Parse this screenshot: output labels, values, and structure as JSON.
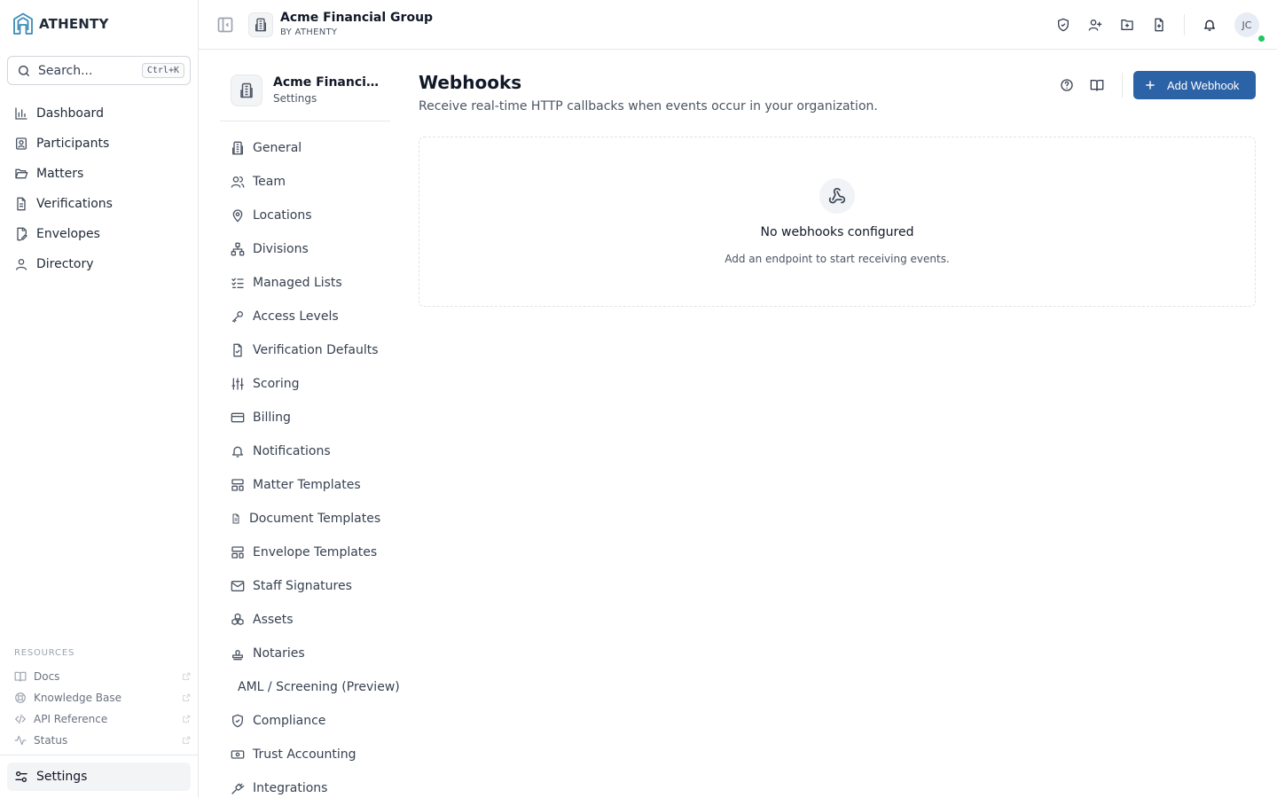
{
  "brand": {
    "name": "ATHENTY",
    "icon": "athenty-logo-icon"
  },
  "search": {
    "placeholder": "Search...",
    "shortcut": "Ctrl+K"
  },
  "nav": [
    {
      "label": "Dashboard",
      "icon": "bar-chart-icon"
    },
    {
      "label": "Participants",
      "icon": "contact-card-icon"
    },
    {
      "label": "Matters",
      "icon": "folder-open-icon"
    },
    {
      "label": "Verifications",
      "icon": "file-text-icon"
    },
    {
      "label": "Envelopes",
      "icon": "file-signature-icon"
    },
    {
      "label": "Directory",
      "icon": "user-icon"
    }
  ],
  "resources": {
    "title": "RESOURCES",
    "items": [
      {
        "label": "Docs",
        "icon": "book-open-icon"
      },
      {
        "label": "Knowledge Base",
        "icon": "life-buoy-icon"
      },
      {
        "label": "API Reference",
        "icon": "code-icon"
      },
      {
        "label": "Status",
        "icon": "activity-icon"
      }
    ]
  },
  "settings_nav": {
    "label": "Settings"
  },
  "header": {
    "org_name": "Acme Financial Group",
    "org_sub": "BY ATHENTY",
    "avatar_initials": "JC"
  },
  "settings_head": {
    "title": "Acme Financial Group",
    "subtitle": "Settings"
  },
  "subnav": [
    {
      "label": "General",
      "icon": "building-icon"
    },
    {
      "label": "Team",
      "icon": "users-icon"
    },
    {
      "label": "Locations",
      "icon": "map-pin-icon"
    },
    {
      "label": "Divisions",
      "icon": "network-icon"
    },
    {
      "label": "Managed Lists",
      "icon": "list-checks-icon"
    },
    {
      "label": "Access Levels",
      "icon": "key-icon"
    },
    {
      "label": "Verification Defaults",
      "icon": "file-check-icon"
    },
    {
      "label": "Scoring",
      "icon": "sliders-icon"
    },
    {
      "label": "Billing",
      "icon": "credit-card-icon"
    },
    {
      "label": "Notifications",
      "icon": "bell-icon"
    },
    {
      "label": "Matter Templates",
      "icon": "layout-template-icon"
    },
    {
      "label": "Document Templates",
      "icon": "file-icon"
    },
    {
      "label": "Envelope Templates",
      "icon": "layout-template-icon"
    },
    {
      "label": "Staff Signatures",
      "icon": "mail-icon"
    },
    {
      "label": "Assets",
      "icon": "boxes-icon"
    },
    {
      "label": "Notaries",
      "icon": "stamp-icon"
    },
    {
      "label": "AML / Screening (Preview)",
      "icon": ""
    },
    {
      "label": "Compliance",
      "icon": "shield-icon"
    },
    {
      "label": "Trust Accounting",
      "icon": "banknote-icon"
    },
    {
      "label": "Integrations",
      "icon": "plug-icon"
    }
  ],
  "main": {
    "title": "Webhooks",
    "description": "Receive real-time HTTP callbacks when events occur in your organization.",
    "add_button": "Add Webhook",
    "empty_title": "No webhooks configured",
    "empty_sub": "Add an endpoint to start receiving events."
  },
  "colors": {
    "accent": "#2c62a6",
    "brand_icon": "#3b8bb5",
    "online": "#22c55e"
  }
}
